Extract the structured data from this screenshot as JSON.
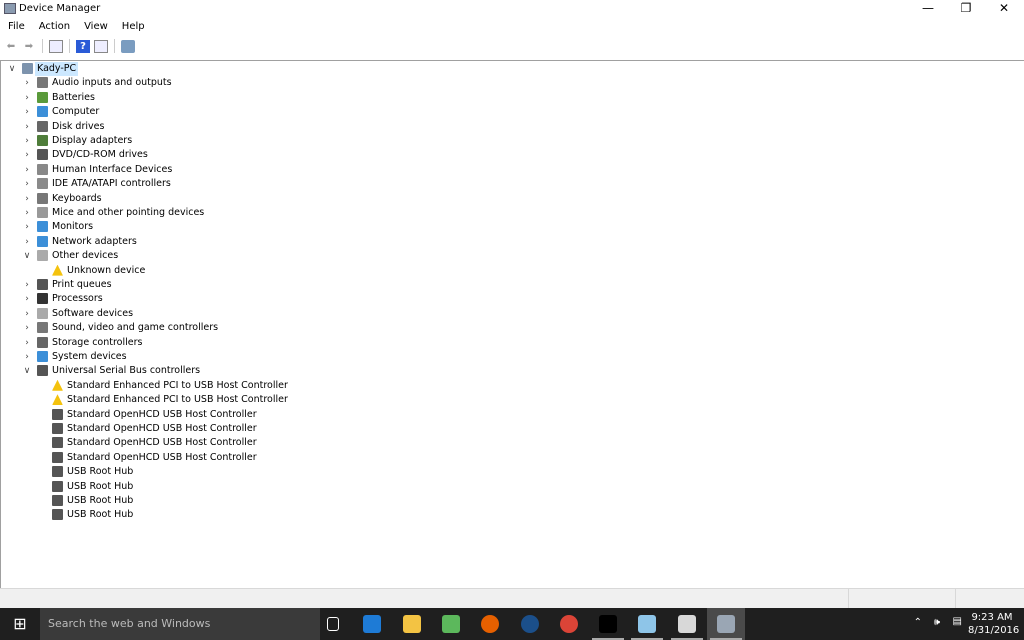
{
  "window": {
    "title": "Device Manager",
    "controls": [
      "minimize",
      "restore",
      "close"
    ]
  },
  "menu": [
    "File",
    "Action",
    "View",
    "Help"
  ],
  "toolbar": [
    "back-icon",
    "forward-icon",
    "show-hide-console-tree-icon",
    "help-icon",
    "properties-icon",
    "scan-hardware-icon"
  ],
  "tree": [
    {
      "level": 0,
      "label": "Kady-PC",
      "expanded": true,
      "icon": "computer",
      "selected": true
    },
    {
      "level": 1,
      "label": "Audio inputs and outputs",
      "icon": "speaker"
    },
    {
      "level": 1,
      "label": "Batteries",
      "icon": "battery"
    },
    {
      "level": 1,
      "label": "Computer",
      "icon": "monitor"
    },
    {
      "level": 1,
      "label": "Disk drives",
      "icon": "disk"
    },
    {
      "level": 1,
      "label": "Display adapters",
      "icon": "display-adapter"
    },
    {
      "level": 1,
      "label": "DVD/CD-ROM drives",
      "icon": "dvd"
    },
    {
      "level": 1,
      "label": "Human Interface Devices",
      "icon": "hid"
    },
    {
      "level": 1,
      "label": "IDE ATA/ATAPI controllers",
      "icon": "ide"
    },
    {
      "level": 1,
      "label": "Keyboards",
      "icon": "keyboard"
    },
    {
      "level": 1,
      "label": "Mice and other pointing devices",
      "icon": "mouse"
    },
    {
      "level": 1,
      "label": "Monitors",
      "icon": "monitor"
    },
    {
      "level": 1,
      "label": "Network adapters",
      "icon": "network"
    },
    {
      "level": 1,
      "label": "Other devices",
      "icon": "other",
      "expanded": true
    },
    {
      "level": 2,
      "label": "Unknown device",
      "icon": "warning"
    },
    {
      "level": 1,
      "label": "Print queues",
      "icon": "printer"
    },
    {
      "level": 1,
      "label": "Processors",
      "icon": "cpu"
    },
    {
      "level": 1,
      "label": "Software devices",
      "icon": "software"
    },
    {
      "level": 1,
      "label": "Sound, video and game controllers",
      "icon": "speaker"
    },
    {
      "level": 1,
      "label": "Storage controllers",
      "icon": "storage"
    },
    {
      "level": 1,
      "label": "System devices",
      "icon": "monitor"
    },
    {
      "level": 1,
      "label": "Universal Serial Bus controllers",
      "icon": "usb",
      "expanded": true
    },
    {
      "level": 2,
      "label": "Standard Enhanced PCI to USB Host Controller",
      "icon": "warning"
    },
    {
      "level": 2,
      "label": "Standard Enhanced PCI to USB Host Controller",
      "icon": "warning"
    },
    {
      "level": 2,
      "label": "Standard OpenHCD USB Host Controller",
      "icon": "usb"
    },
    {
      "level": 2,
      "label": "Standard OpenHCD USB Host Controller",
      "icon": "usb"
    },
    {
      "level": 2,
      "label": "Standard OpenHCD USB Host Controller",
      "icon": "usb"
    },
    {
      "level": 2,
      "label": "Standard OpenHCD USB Host Controller",
      "icon": "usb"
    },
    {
      "level": 2,
      "label": "USB Root Hub",
      "icon": "usb"
    },
    {
      "level": 2,
      "label": "USB Root Hub",
      "icon": "usb"
    },
    {
      "level": 2,
      "label": "USB Root Hub",
      "icon": "usb"
    },
    {
      "level": 2,
      "label": "USB Root Hub",
      "icon": "usb"
    }
  ],
  "taskbar": {
    "search_placeholder": "Search the web and Windows",
    "apps": [
      {
        "name": "task-view",
        "color": "#1f1f1f"
      },
      {
        "name": "edge",
        "color": "#1e7bd6"
      },
      {
        "name": "file-explorer",
        "color": "#f3c343"
      },
      {
        "name": "money-app",
        "color": "#5cb85c"
      },
      {
        "name": "firefox",
        "color": "#e66000"
      },
      {
        "name": "steam",
        "color": "#1b4f8a"
      },
      {
        "name": "chrome",
        "color": "#db4437"
      },
      {
        "name": "command-prompt",
        "color": "#000000"
      },
      {
        "name": "notepad-app",
        "color": "#8ec5e8"
      },
      {
        "name": "paint-app",
        "color": "#d8d8d8"
      },
      {
        "name": "device-manager",
        "color": "#9aa6b4",
        "active": true
      }
    ],
    "time": "9:23 AM",
    "date": "8/31/2016"
  },
  "colors": {
    "selection": "#cce8ff",
    "taskbar": "#1f1f1f",
    "warning": "#f4c20d"
  }
}
